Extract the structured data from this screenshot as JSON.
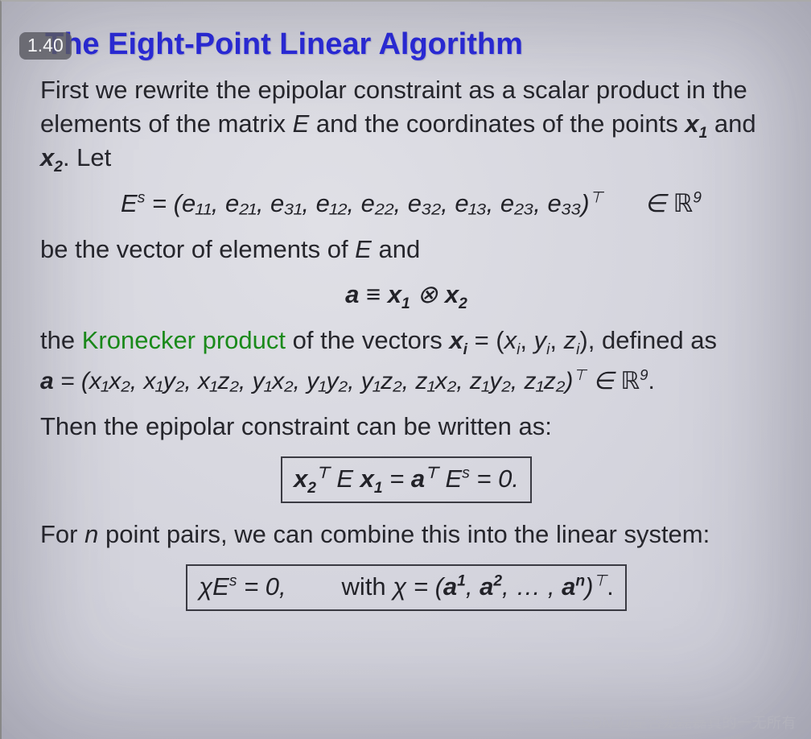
{
  "badge": "1.40",
  "title": "The Eight-Point Linear Algorithm",
  "para1_a": "First we rewrite the epipolar constraint as a scalar product in the elements of the matrix ",
  "para1_b": " and the coordinates of the points ",
  "para1_c": " and ",
  "para1_d": ". Let",
  "E": "E",
  "x1": "x",
  "x1_sub": "1",
  "x2": "x",
  "x2_sub": "2",
  "eq1_lhs_E": "E",
  "eq1_lhs_sup": "s",
  "eq1_eq": " = ",
  "eq1_vec_open": "(",
  "eq1_items": "e₁₁, e₂₁, e₃₁, e₁₂, e₂₂, e₃₂, e₁₃, e₂₃, e₃₃",
  "eq1_vec_close": ")",
  "eq1_T": "⊤",
  "eq1_in": "∈ ",
  "eq1_R": "ℝ",
  "eq1_9": "9",
  "para2_a": "be the vector of elements of ",
  "para2_b": " and",
  "eq2_a": "a",
  "eq2_equiv": " ≡ ",
  "eq2_x1": "x",
  "eq2_x1_sub": "1",
  "eq2_otimes": " ⊗ ",
  "eq2_x2": "x",
  "eq2_x2_sub": "2",
  "para3_a": "the ",
  "kron": "Kronecker product",
  "para3_b": " of the vectors ",
  "para3_c": " = (",
  "para3_d": ", ",
  "para3_e": "), defined as",
  "xi_x": "x",
  "xi_i": "i",
  "xi_comp_x": "x",
  "xi_comp_y": "y",
  "xi_comp_z": "z",
  "eq3_a": "a",
  "eq3_eq": " = ",
  "eq3_vec": "(x₁x₂, x₁y₂, x₁z₂, y₁x₂, y₁y₂, y₁z₂, z₁x₂, z₁y₂, z₁z₂)",
  "eq3_T": "⊤",
  "eq3_in": " ∈ ",
  "eq3_R": "ℝ",
  "eq3_9": "9",
  "eq3_dot": ".",
  "para4": "Then the epipolar constraint can be written as:",
  "eq4_x2": "x",
  "eq4_x2_sub": "2",
  "eq4_x2_sup": "⊤",
  "eq4_sp": " ",
  "eq4_E": "E ",
  "eq4_x1": "x",
  "eq4_x1_sub": "1",
  "eq4_eq1": " = ",
  "eq4_a": "a",
  "eq4_a_sup": "⊤",
  "eq4_Es_E": "E",
  "eq4_Es_s": "s",
  "eq4_eq2": " = 0.",
  "para5_a": "For ",
  "para5_n": "n",
  "para5_b": " point pairs, we can combine this into the linear system:",
  "eq5_chi": "χ",
  "eq5_E": "E",
  "eq5_s": "s",
  "eq5_eq0": " = 0,",
  "eq5_with": "with ",
  "eq5_chi2": "χ",
  "eq5_eq": " = ",
  "eq5_open": "(",
  "eq5_a1_a": "a",
  "eq5_a1_sup": "1",
  "eq5_c1": ", ",
  "eq5_a2_a": "a",
  "eq5_a2_sup": "2",
  "eq5_c2": ", … , ",
  "eq5_an_a": "a",
  "eq5_an_sup": "n",
  "eq5_close": ")",
  "eq5_T": "⊤",
  "eq5_dot": ".",
  "watermark": "CSDN @是否龙磊磊真的一无所有"
}
